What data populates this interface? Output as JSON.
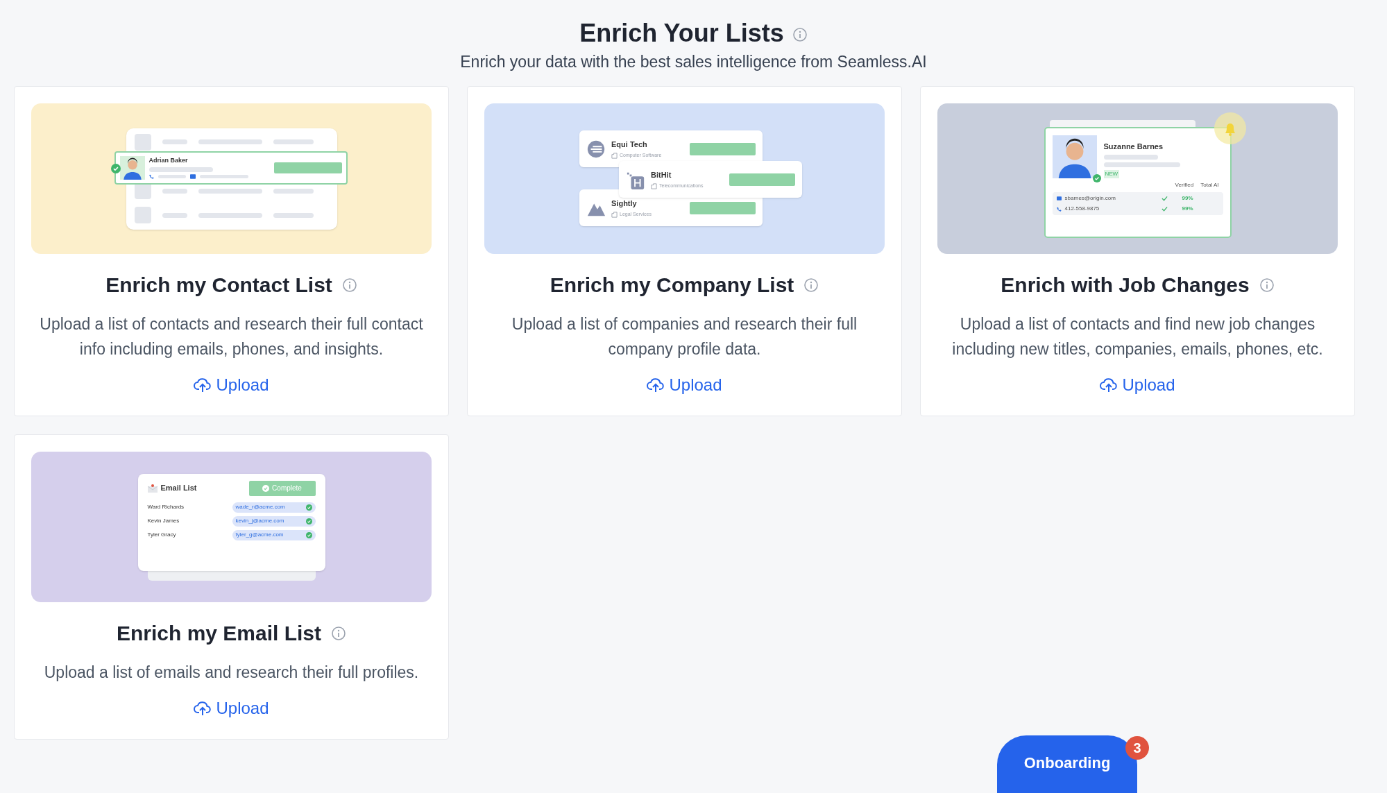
{
  "header": {
    "title": "Enrich Your Lists",
    "subtitle": "Enrich your data with the best sales intelligence from Seamless.AI"
  },
  "cards": [
    {
      "title": "Enrich my Contact List",
      "description": "Upload a list of contacts and research their full contact info including emails, phones, and insights.",
      "action": "Upload",
      "illustration": {
        "kind": "contact",
        "name": "Adrian Baker"
      }
    },
    {
      "title": "Enrich my Company List",
      "description": "Upload a list of companies and research their full company profile data.",
      "action": "Upload",
      "illustration": {
        "kind": "company",
        "companies": [
          {
            "name": "Equi Tech",
            "industry": "Computer Software"
          },
          {
            "name": "BitHit",
            "industry": "Telecommunications"
          },
          {
            "name": "Sightly",
            "industry": "Legal Services"
          }
        ]
      }
    },
    {
      "title": "Enrich with Job Changes",
      "description": "Upload a list of contacts and find new job changes including new titles, companies, emails, phones, etc.",
      "action": "Upload",
      "illustration": {
        "kind": "job",
        "name": "Suzanne Barnes",
        "tag": "NEW",
        "columns": [
          "Verified",
          "Total AI"
        ],
        "rows": [
          {
            "value": "sbarnes@origin.com",
            "score": "99%"
          },
          {
            "value": "412-558-9875",
            "score": "99%"
          }
        ]
      }
    },
    {
      "title": "Enrich my Email List",
      "description": "Upload a list of emails and research their full profiles.",
      "action": "Upload",
      "illustration": {
        "kind": "email",
        "title": "Email List",
        "status": "Complete",
        "rows": [
          {
            "name": "Ward Richards",
            "email": "wade_r@acme.com"
          },
          {
            "name": "Kevin James",
            "email": "kevin_j@acme.com"
          },
          {
            "name": "Tyler Gracy",
            "email": "tyler_g@acme.com"
          }
        ]
      }
    }
  ],
  "onboarding": {
    "label": "Onboarding",
    "badge": "3"
  }
}
